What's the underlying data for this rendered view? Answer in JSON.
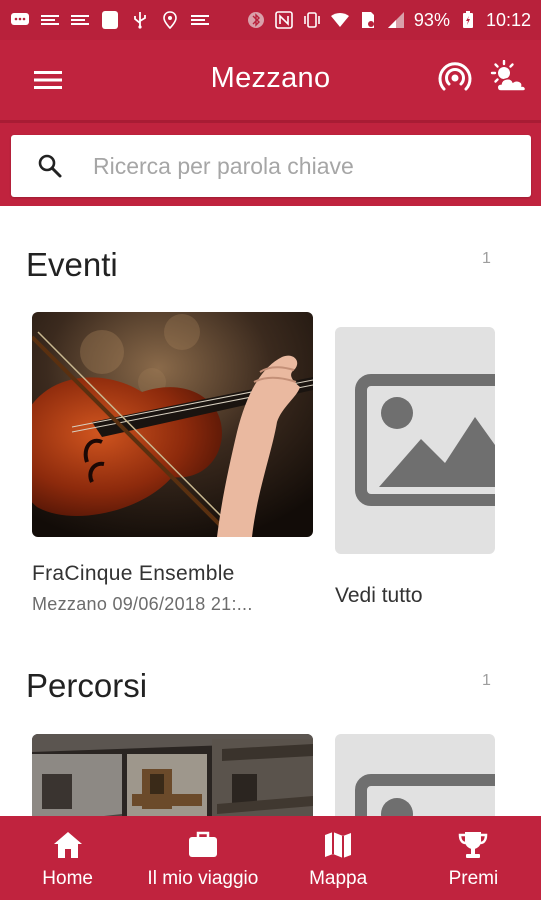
{
  "status_bar": {
    "battery": "93%",
    "time": "10:12"
  },
  "app_bar": {
    "title": "Mezzano",
    "icons": [
      "menu-icon",
      "beacon-icon",
      "weather-icon"
    ]
  },
  "search": {
    "placeholder": "Ricerca per parola chiave"
  },
  "sections": [
    {
      "title": "Eventi",
      "count": "1",
      "cards": [
        {
          "title": "FraCinque Ensemble",
          "subtitle": "Mezzano 09/06/2018 21:..."
        }
      ],
      "see_all": "Vedi tutto"
    },
    {
      "title": "Percorsi",
      "count": "1"
    }
  ],
  "bottom_nav": [
    {
      "label": "Home",
      "icon": "home-icon"
    },
    {
      "label": "Il mio viaggio",
      "icon": "briefcase-icon"
    },
    {
      "label": "Mappa",
      "icon": "map-icon"
    },
    {
      "label": "Premi",
      "icon": "trophy-icon"
    }
  ],
  "colors": {
    "primary": "#c0233e",
    "status_bar": "#b8213b",
    "placeholder_bg": "#e1e1e1",
    "placeholder_icon": "#6f6f6f"
  }
}
